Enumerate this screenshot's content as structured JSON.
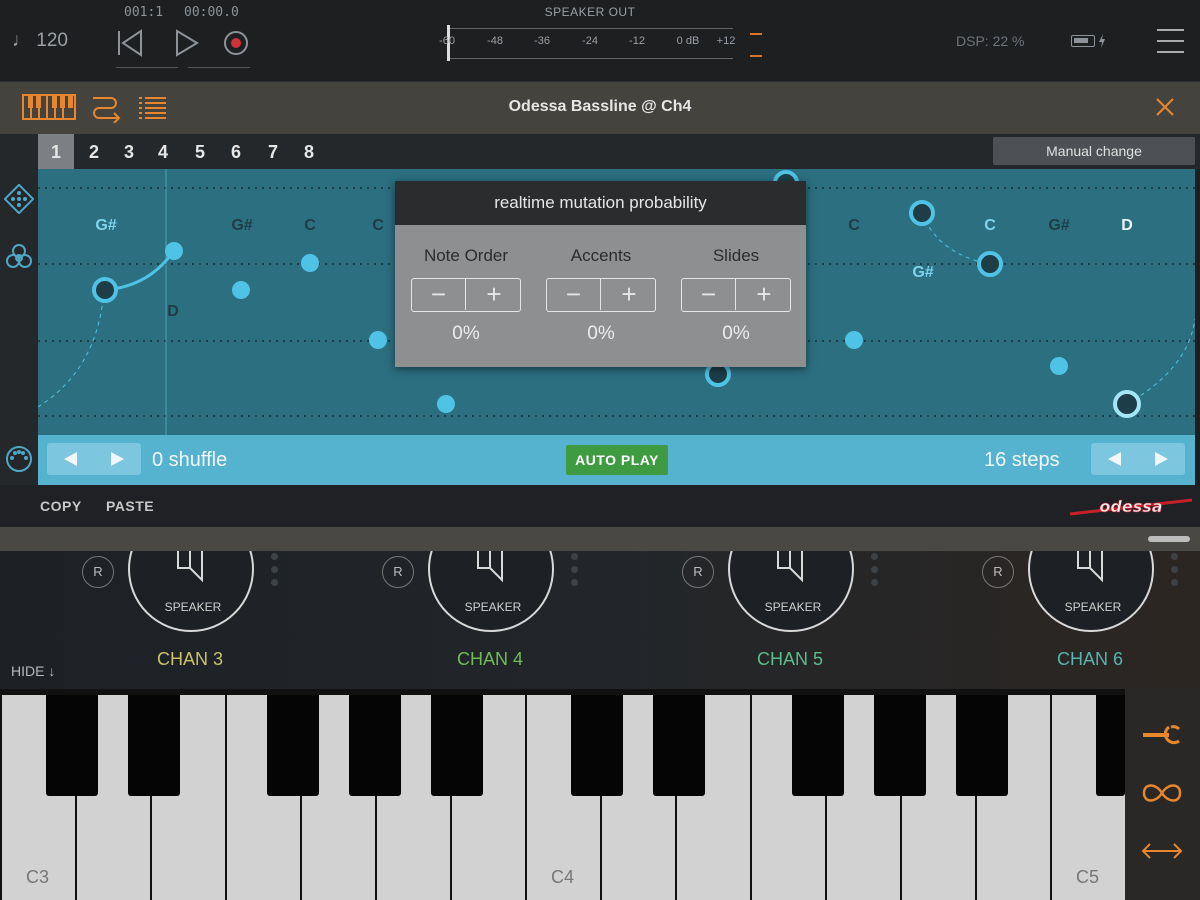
{
  "transport": {
    "tempo": "♩ 120",
    "position": "001:1",
    "time": "00:00.0",
    "meter_title": "SPEAKER OUT",
    "meter_marks": [
      "-60",
      "-48",
      "-36",
      "-24",
      "-12",
      "0 dB",
      "+12"
    ],
    "dsp": "DSP: 22 %"
  },
  "header": {
    "title": "Odessa Bassline @ Ch4"
  },
  "tabs": {
    "items": [
      "1",
      "2",
      "3",
      "4",
      "5",
      "6",
      "7",
      "8"
    ],
    "active": "1",
    "manual_change": "Manual change"
  },
  "grid": {
    "note_labels": {
      "gs1": "G#",
      "d1": "D",
      "gs2": "G#",
      "c1": "C",
      "c2": "C",
      "c3": "C",
      "gs3": "G#",
      "c4": "C",
      "gs4": "G#",
      "d2": "D"
    }
  },
  "popup": {
    "title": "realtime mutation probability",
    "controls": [
      {
        "label": "Note Order",
        "value": "0%"
      },
      {
        "label": "Accents",
        "value": "0%"
      },
      {
        "label": "Slides",
        "value": "0%"
      }
    ]
  },
  "strip": {
    "shuffle": "0 shuffle",
    "autoplay": "AUTO PLAY",
    "steps": "16 steps"
  },
  "clipboard": {
    "copy": "COPY",
    "paste": "PASTE",
    "logo": "odessa"
  },
  "mixer": {
    "record_label": "R",
    "knob_label": "SPEAKER",
    "hide": "HIDE ↓",
    "channels": [
      {
        "name": "CHAN 3",
        "color": "#c9c26a"
      },
      {
        "name": "CHAN 4",
        "color": "#6ebc56"
      },
      {
        "name": "CHAN 5",
        "color": "#5cbc8a"
      },
      {
        "name": "CHAN 6",
        "color": "#5ab3ad"
      }
    ]
  },
  "keyboard": {
    "labels": [
      "C3",
      "C4",
      "C5"
    ]
  },
  "colors": {
    "accent_orange": "#e8862d",
    "grid_teal": "#2b6f80",
    "strip_blue": "#56b3d0",
    "note_blue": "#4fc3e6"
  }
}
